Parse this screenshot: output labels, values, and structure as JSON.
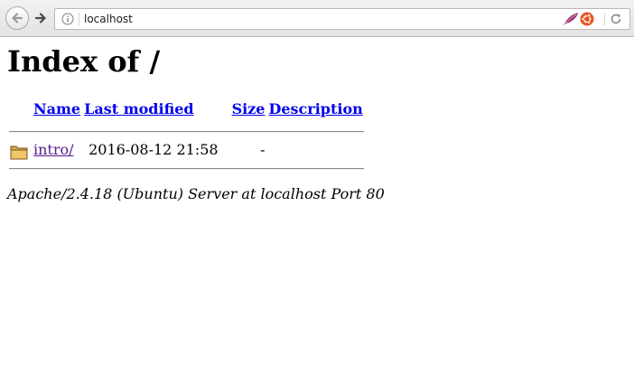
{
  "browser": {
    "url": "localhost",
    "icons": {
      "back": "back-arrow-icon",
      "forward": "forward-arrow-icon",
      "info": "info-icon",
      "extension_1": "feather-icon",
      "extension_2": "ubuntu-logo-icon",
      "reload": "reload-icon"
    }
  },
  "page": {
    "title": "Index of /",
    "columns": {
      "name": "Name",
      "last_modified": "Last modified",
      "size": "Size",
      "description": "Description"
    },
    "entries": [
      {
        "icon": "folder-icon",
        "name": "intro/",
        "last_modified": "2016-08-12 21:58",
        "size": "-",
        "description": ""
      }
    ],
    "footer": "Apache/2.4.18 (Ubuntu) Server at localhost Port 80"
  },
  "colors": {
    "link": "#0000ee",
    "visited_link": "#551a8b",
    "toolbar_bg": "#e8e8e8",
    "ubuntu_orange": "#e95420"
  }
}
